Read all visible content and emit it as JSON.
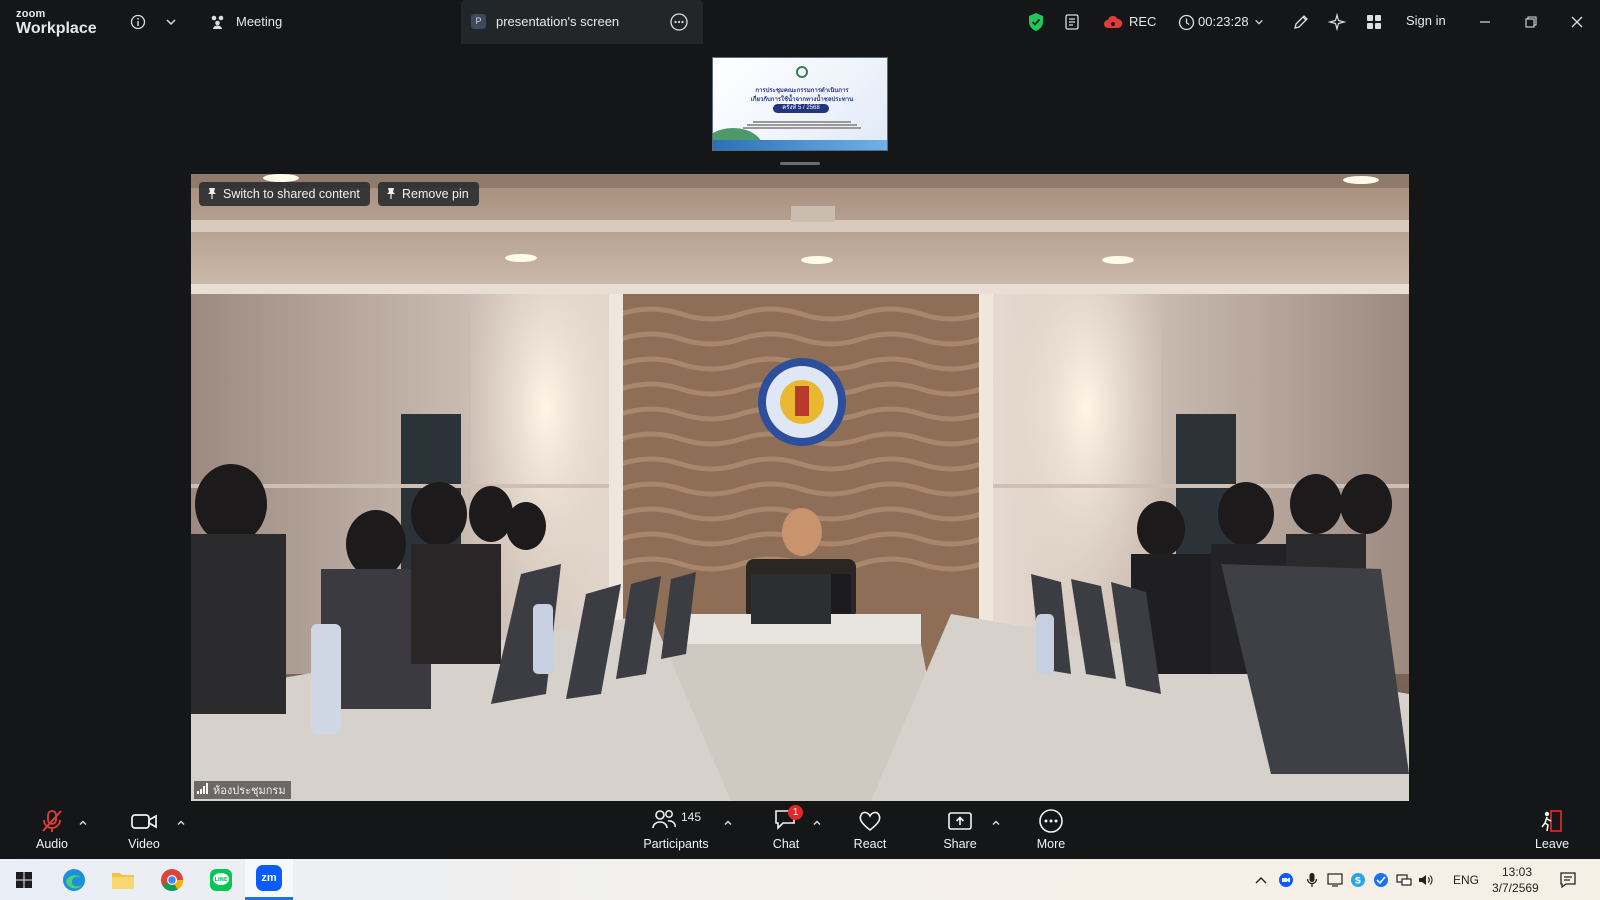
{
  "app": {
    "logo_line1": "zoom",
    "logo_line2": "Workplace",
    "meeting_label": "Meeting",
    "tab_badge": "P",
    "tab_title": "presentation's screen",
    "rec_label": "REC",
    "timer": "00:23:28",
    "sign_in": "Sign in"
  },
  "slide": {
    "title_line1": "การประชุมคณะกรรมการดำเนินการ",
    "title_line2": "เกี่ยวกับการใช้น้ำจากทางน้ำชลประทาน",
    "session": "ครั้งที่ 5 / 2568"
  },
  "video": {
    "switch_label": "Switch to shared content",
    "remove_pin_label": "Remove pin",
    "participant_name": "ห้องประชุมกรม"
  },
  "controls": {
    "audio": "Audio",
    "video": "Video",
    "participants": "Participants",
    "participants_count": "145",
    "chat": "Chat",
    "chat_badge": "1",
    "react": "React",
    "share": "Share",
    "more": "More",
    "leave": "Leave"
  },
  "taskbar": {
    "language": "ENG",
    "time": "13:03",
    "date": "3/7/2569",
    "zoom_app_label": "zm"
  },
  "colors": {
    "background": "#141618",
    "security_green": "#22c55e",
    "chat_badge_red": "#e02828",
    "mute_red": "#e23b3b",
    "leave_red": "#e02828"
  }
}
